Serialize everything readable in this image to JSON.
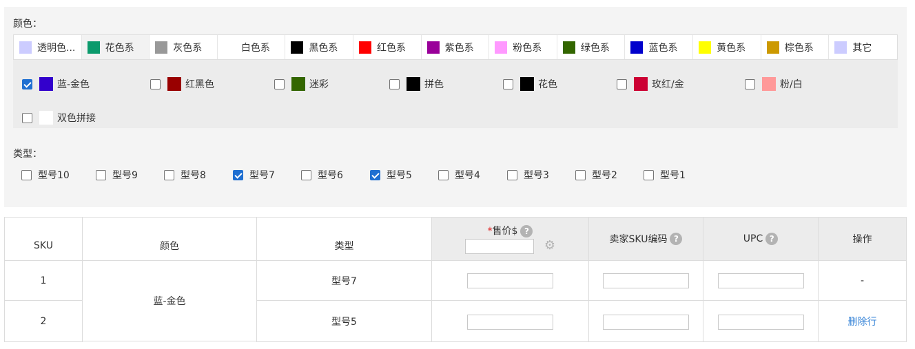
{
  "color_section": {
    "label": "颜色：",
    "tabs": [
      {
        "label": "透明色...",
        "swatch": "#ccccff",
        "active": false
      },
      {
        "label": "花色系",
        "swatch": "#0b9a6c",
        "active": true
      },
      {
        "label": "灰色系",
        "swatch": "#999999",
        "active": false
      },
      {
        "label": "白色系",
        "swatch": "#ffffff",
        "active": false
      },
      {
        "label": "黑色系",
        "swatch": "#000000",
        "active": false
      },
      {
        "label": "红色系",
        "swatch": "#ff0000",
        "active": false
      },
      {
        "label": "紫色系",
        "swatch": "#990099",
        "active": false
      },
      {
        "label": "粉色系",
        "swatch": "#ff99ff",
        "active": false
      },
      {
        "label": "绿色系",
        "swatch": "#336600",
        "active": false
      },
      {
        "label": "蓝色系",
        "swatch": "#0000cc",
        "active": false
      },
      {
        "label": "黄色系",
        "swatch": "#ffff00",
        "active": false
      },
      {
        "label": "棕色系",
        "swatch": "#cc9900",
        "active": false
      },
      {
        "label": "其它",
        "swatch": "#ccccff",
        "active": false
      }
    ],
    "options": [
      {
        "label": "蓝-金色",
        "swatch": "#3300cc",
        "checked": true
      },
      {
        "label": "红黑色",
        "swatch": "#990000",
        "checked": false
      },
      {
        "label": "迷彩",
        "swatch": "#336600",
        "checked": false
      },
      {
        "label": "拼色",
        "swatch": "#000000",
        "checked": false
      },
      {
        "label": "花色",
        "swatch": "#000000",
        "checked": false
      },
      {
        "label": "玫红/金",
        "swatch": "#cc0033",
        "checked": false
      },
      {
        "label": "粉/白",
        "swatch": "#ff9999",
        "checked": false
      },
      {
        "label": "双色拼接",
        "swatch": "#ffffff",
        "checked": false
      }
    ]
  },
  "type_section": {
    "label": "类型：",
    "options": [
      {
        "label": "型号10",
        "checked": false
      },
      {
        "label": "型号9",
        "checked": false
      },
      {
        "label": "型号8",
        "checked": false
      },
      {
        "label": "型号7",
        "checked": true
      },
      {
        "label": "型号6",
        "checked": false
      },
      {
        "label": "型号5",
        "checked": true
      },
      {
        "label": "型号4",
        "checked": false
      },
      {
        "label": "型号3",
        "checked": false
      },
      {
        "label": "型号2",
        "checked": false
      },
      {
        "label": "型号1",
        "checked": false
      }
    ]
  },
  "table": {
    "headers": {
      "sku": "SKU",
      "color": "颜色",
      "type": "类型",
      "price_required_mark": "*",
      "price": "售价$",
      "seller_sku": "卖家SKU编码",
      "upc": "UPC",
      "actions": "操作"
    },
    "price_batch_value": "",
    "help_glyph": "?",
    "gear_glyph": "⚙",
    "color_merged": "蓝-金色",
    "rows": [
      {
        "sku": "1",
        "type": "型号7",
        "price": "",
        "seller_sku": "",
        "upc": "",
        "action": "-"
      },
      {
        "sku": "2",
        "type": "型号5",
        "price": "",
        "seller_sku": "",
        "upc": "",
        "action": "删除行"
      }
    ]
  }
}
